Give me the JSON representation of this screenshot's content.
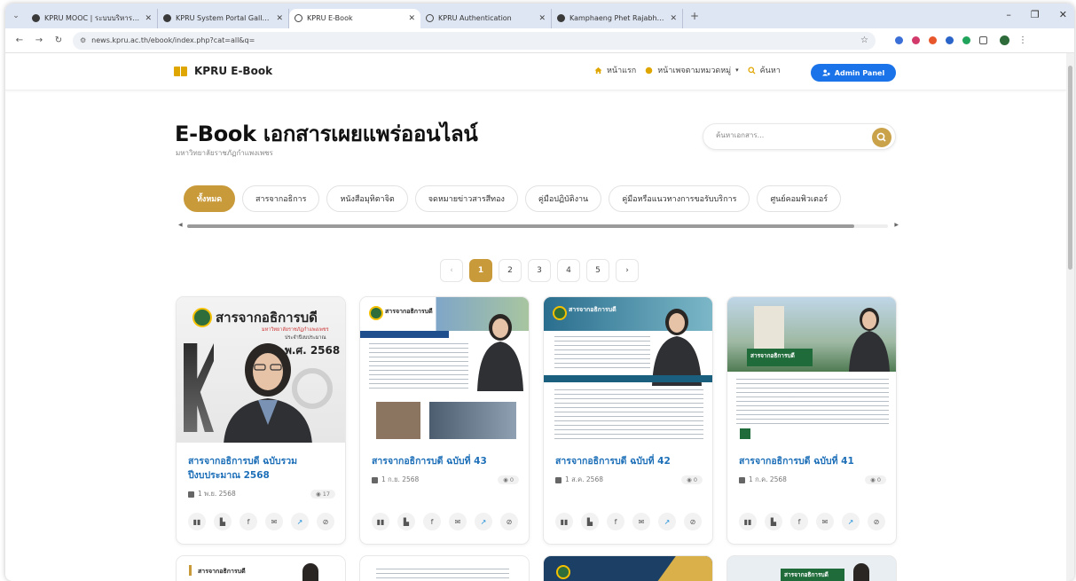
{
  "browser": {
    "tabs": [
      {
        "title": "KPRU MOOC | ระบบบริหารจัดการ",
        "active": false
      },
      {
        "title": "KPRU System Portal Gallery",
        "active": false
      },
      {
        "title": "KPRU E-Book",
        "active": true
      },
      {
        "title": "KPRU Authentication",
        "active": false
      },
      {
        "title": "Kamphaeng Phet Rajabhat Uni",
        "active": false
      }
    ],
    "url": "news.kpru.ac.th/ebook/index.php?cat=all&q="
  },
  "header": {
    "brand": "KPRU E-Book",
    "nav": [
      {
        "label": "หน้าแรก",
        "icon": "home-icon"
      },
      {
        "label": "หน้าเพจตามหมวดหมู่",
        "icon": "folder-icon"
      },
      {
        "label": "ค้นหา",
        "icon": "search-icon"
      }
    ],
    "admin_label": "Admin Panel"
  },
  "hero": {
    "title": "E-Book เอกสารเผยแพร่ออนไลน์",
    "subtitle": "มหาวิทยาลัยราชภัฏกำแพงเพชร",
    "search_placeholder": "ค้นหาเอกสาร..."
  },
  "categories": [
    "ทั้งหมด",
    "สารจากอธิการ",
    "หนังสือมุทิตาจิต",
    "จดหมายข่าวสารสีทอง",
    "คู่มือปฏิบัติงาน",
    "คู่มือหรือแนวทางการขอรับบริการ",
    "ศูนย์คอมพิวเตอร์"
  ],
  "active_category": 0,
  "pagination": {
    "pages": [
      "1",
      "2",
      "3",
      "4",
      "5"
    ],
    "current": 1,
    "prev": "‹",
    "next": "›"
  },
  "cards": [
    {
      "title": "สารจากอธิการบดี ฉบับรวมปีงบประมาณ 2568",
      "date": "1 พ.ย. 2568",
      "views": "17",
      "cover": {
        "heading": "สารจากอธิการบดี",
        "sub": "มหาวิทยาลัยราชภัฏกำแพงเพชร",
        "note": "ประจำปีงบประมาณ",
        "year": "พ.ศ. 2568"
      }
    },
    {
      "title": "สารจากอธิการบดี ฉบับที่ 43",
      "date": "1 ก.ย. 2568",
      "views": "0",
      "cover": {
        "heading": "สารจากอธิการบดี"
      }
    },
    {
      "title": "สารจากอธิการบดี ฉบับที่ 42",
      "date": "1 ส.ค. 2568",
      "views": "0",
      "cover": {
        "heading": "สารจากอธิการบดี"
      }
    },
    {
      "title": "สารจากอธิการบดี ฉบับที่ 41",
      "date": "1 ก.ค. 2568",
      "views": "0",
      "cover": {
        "heading": "สารจากอธิการบดี"
      }
    }
  ],
  "next_row": [
    {
      "cover_heading": "สารจากอธิการบดี"
    },
    {
      "cover_heading": ""
    },
    {
      "cover_heading": ""
    },
    {
      "cover_heading": "สารจากอธิการบดี"
    }
  ],
  "colors": {
    "accent": "#c99a3a",
    "link": "#1d6fb8",
    "admin": "#1a73e8",
    "brand_icon": "#e0a600"
  }
}
